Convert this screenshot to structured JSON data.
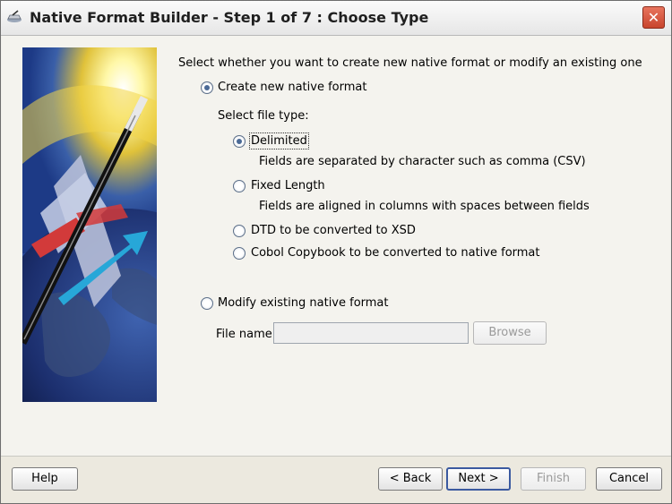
{
  "window": {
    "title": "Native Format Builder - Step 1 of 7 : Choose Type",
    "close_symbol": "✕"
  },
  "intro": "Select whether you want to create new native format or modify an existing one",
  "options": {
    "create_new": "Create new native format",
    "select_file_type": "Select file type:",
    "delimited": "Delimited",
    "delimited_desc": "Fields are separated by character such as comma (CSV)",
    "fixed_length": "Fixed Length",
    "fixed_length_desc": "Fields are aligned in columns with spaces between fields",
    "dtd": "DTD to be converted to XSD",
    "cobol": "Cobol Copybook to be converted to native format",
    "modify_existing": "Modify existing native format"
  },
  "file": {
    "label": "File name:",
    "value": "",
    "browse": "Browse"
  },
  "buttons": {
    "help": "Help",
    "back": "< Back",
    "next": "Next >",
    "finish": "Finish",
    "cancel": "Cancel"
  },
  "icons": {
    "app": "wand-icon",
    "close": "close-icon",
    "art": "wizard-wand-globe-illustration"
  }
}
